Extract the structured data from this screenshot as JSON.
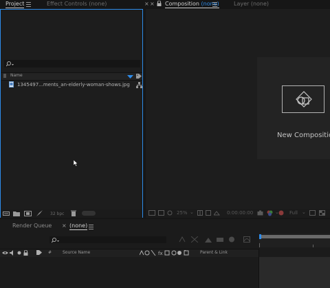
{
  "project_panel": {
    "tab_label": "Project",
    "effect_controls_label": "Effect Controls (none)",
    "search_placeholder": "",
    "column_name": "Name",
    "files": [
      {
        "name": "1345497...ments_an-elderly-woman-shows.jpg"
      }
    ],
    "bpc_label": "32 bpc"
  },
  "composition_panel": {
    "tab_prefix": "Composition",
    "tab_suffix": "(none)",
    "layer_label": "Layer (none)",
    "new_comp_label": "New Composition",
    "zoom_value": "25%",
    "timecode": "0:00:00:00",
    "resolution_value": "Full"
  },
  "timeline_panel": {
    "render_queue_label": "Render Queue",
    "tab_label": "(none)",
    "column_hash": "#",
    "column_source_name": "Source Name",
    "column_parent_link": "Parent & Link"
  },
  "colors": {
    "accent_blue": "#2d8ceb",
    "panel_bg": "#1d1d1d",
    "app_bg": "#161616"
  }
}
